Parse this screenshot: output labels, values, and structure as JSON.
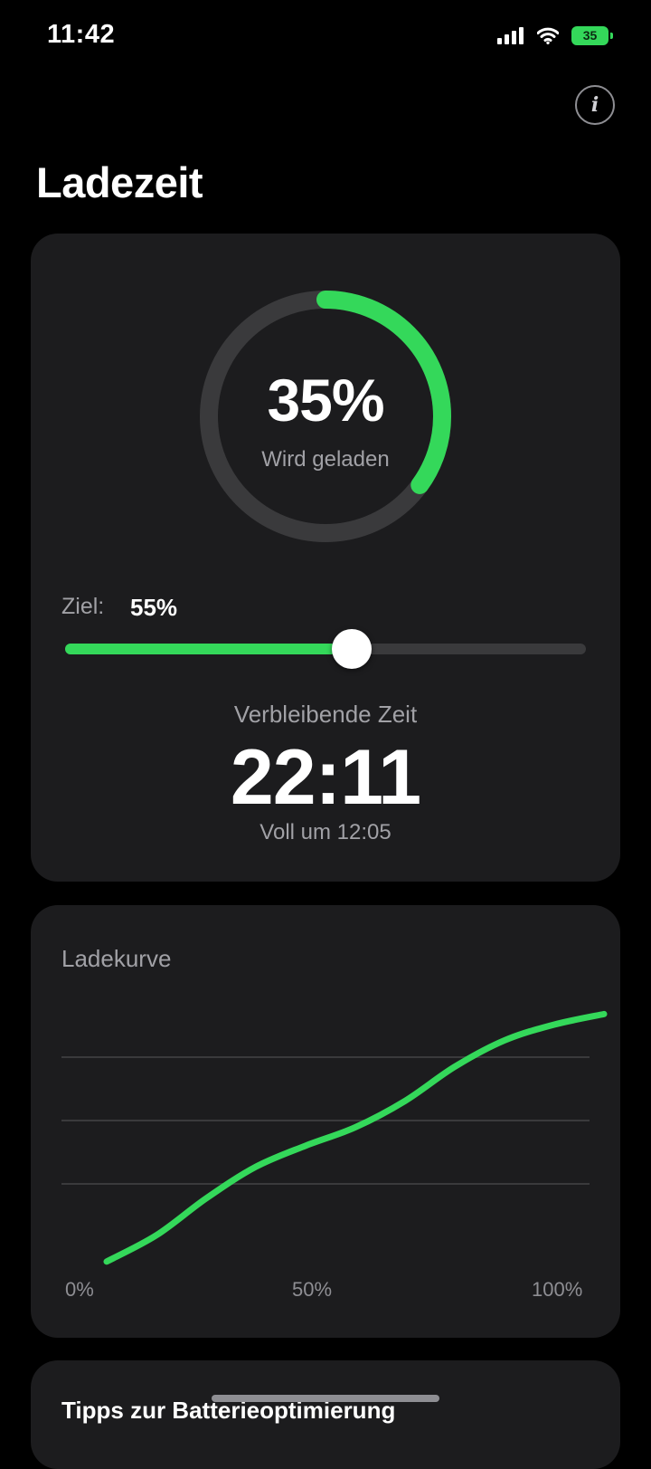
{
  "status_bar": {
    "time": "11:42",
    "battery_level": "35"
  },
  "header": {
    "title": "Ladezeit",
    "info_icon": "info-icon"
  },
  "charge": {
    "percent_label": "35%",
    "percent_value": 35,
    "status": "Wird geladen",
    "target_label": "Ziel:",
    "target_value": "55%",
    "target_fraction": 0.55,
    "remaining_label": "Verbleibende Zeit",
    "remaining_time": "22:11",
    "full_at": "Voll um 12:05"
  },
  "curve": {
    "title": "Ladekurve",
    "x_ticks": [
      "0%",
      "50%",
      "100%"
    ]
  },
  "tips": {
    "title": "Tipps zur Batterieoptimierung"
  },
  "colors": {
    "accent": "#34d85a",
    "card": "#1c1c1e",
    "track": "#3a3a3c",
    "secondary_text": "#a1a1a6"
  },
  "chart_data": {
    "type": "line",
    "title": "Ladekurve",
    "x": [
      0,
      10,
      20,
      30,
      40,
      50,
      60,
      70,
      80,
      90,
      100
    ],
    "series": [
      {
        "values": [
          0.09,
          0.19,
          0.33,
          0.45,
          0.53,
          0.6,
          0.7,
          0.83,
          0.93,
          0.99,
          1.03
        ]
      }
    ],
    "xlim": [
      0,
      100
    ],
    "ylim": [
      0,
      1.1
    ],
    "x_tick_labels": [
      "0%",
      "50%",
      "100%"
    ],
    "grid": "horizontal",
    "xlabel": "",
    "ylabel": ""
  }
}
